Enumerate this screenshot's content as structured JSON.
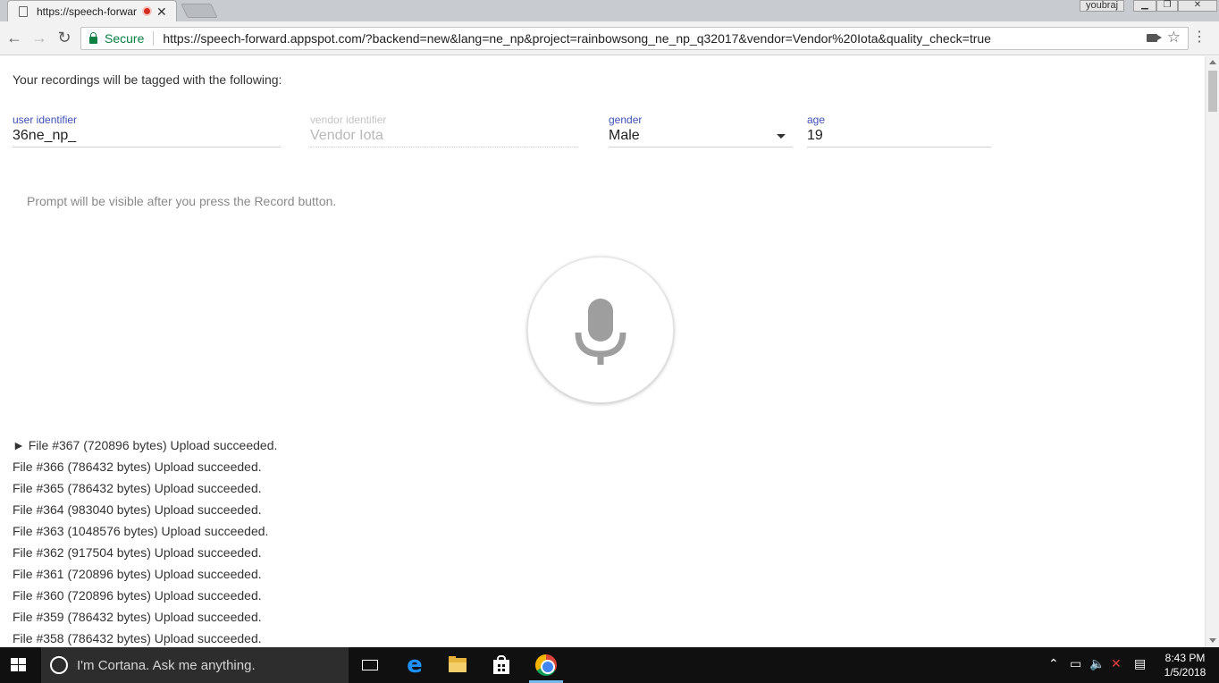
{
  "browser": {
    "tab_title": "https://speech-forwar",
    "profile_name": "youbraj",
    "secure_label": "Secure",
    "url": "https://speech-forward.appspot.com/?backend=new&lang=ne_np&project=rainbowsong_ne_np_q32017&vendor=Vendor%20Iota&quality_check=true"
  },
  "page": {
    "tag_heading": "Your recordings will be tagged with the following:",
    "fields": {
      "user_identifier": {
        "label": "user identifier",
        "value": "36ne_np_"
      },
      "vendor_identifier": {
        "label": "vendor identifier",
        "value": "Vendor Iota"
      },
      "gender": {
        "label": "gender",
        "value": "Male"
      },
      "age": {
        "label": "age",
        "value": "19"
      }
    },
    "prompt_text": "Prompt will be visible after you press the Record button.",
    "files": [
      "► File #367 (720896 bytes) Upload succeeded.",
      "File #366 (786432 bytes) Upload succeeded.",
      "File #365 (786432 bytes) Upload succeeded.",
      "File #364 (983040 bytes) Upload succeeded.",
      "File #363 (1048576 bytes) Upload succeeded.",
      "File #362 (917504 bytes) Upload succeeded.",
      "File #361 (720896 bytes) Upload succeeded.",
      "File #360 (720896 bytes) Upload succeeded.",
      "File #359 (786432 bytes) Upload succeeded.",
      "File #358 (786432 bytes) Upload succeeded."
    ]
  },
  "taskbar": {
    "cortana_placeholder": "I'm Cortana. Ask me anything.",
    "time": "8:43 PM",
    "date": "1/5/2018"
  },
  "colors": {
    "accent": "#3f51b5",
    "secure": "#0b8043",
    "recording": "#d52b1e",
    "mic": "#9e9e9e"
  }
}
